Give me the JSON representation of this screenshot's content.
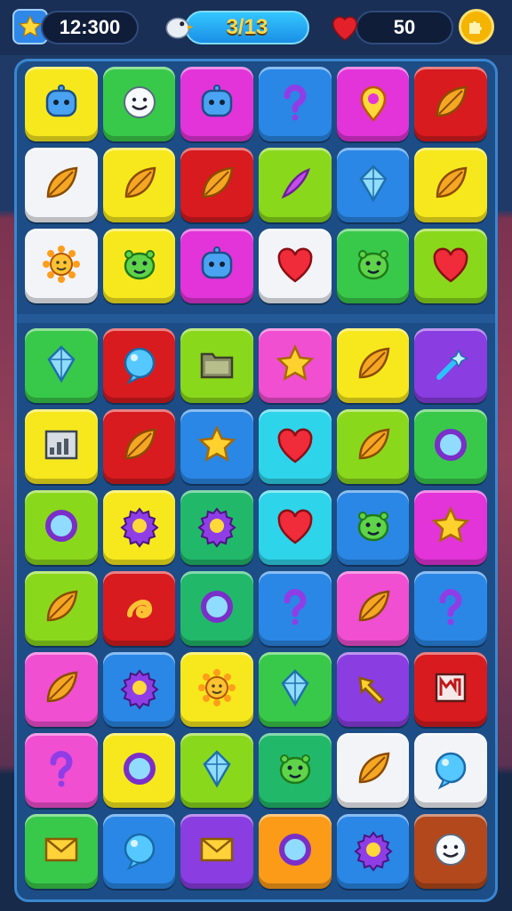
{
  "hud": {
    "score": "12:300",
    "level": "3/13",
    "lives": "50"
  },
  "colors": {
    "yellow": "#f7e81d",
    "green": "#39c94a",
    "lime": "#8ad81c",
    "magenta": "#e234d8",
    "blue": "#2a87e6",
    "red": "#d81b1f",
    "white": "#f2f4f8",
    "purple": "#8a3de0",
    "cyan": "#2ed4ea",
    "pink": "#f04fd1",
    "orange": "#fb9b18",
    "brown": "#b2481c",
    "emerald": "#22b86a"
  },
  "board": {
    "top_rows": [
      [
        {
          "color": "yellow",
          "icon": "robot-icon"
        },
        {
          "color": "green",
          "icon": "smiley-icon"
        },
        {
          "color": "magenta",
          "icon": "robot-icon"
        },
        {
          "color": "blue",
          "icon": "question-icon"
        },
        {
          "color": "magenta",
          "icon": "location-pin-icon"
        },
        {
          "color": "red",
          "icon": "leaf-icon"
        }
      ],
      [
        {
          "color": "white",
          "icon": "leaf-icon"
        },
        {
          "color": "yellow",
          "icon": "leaf-icon"
        },
        {
          "color": "red",
          "icon": "leaf-icon"
        },
        {
          "color": "lime",
          "icon": "feather-icon"
        },
        {
          "color": "blue",
          "icon": "crystal-icon"
        },
        {
          "color": "yellow",
          "icon": "leaf-icon"
        }
      ],
      [
        {
          "color": "white",
          "icon": "sun-icon"
        },
        {
          "color": "yellow",
          "icon": "monster-icon"
        },
        {
          "color": "magenta",
          "icon": "robot-icon"
        },
        {
          "color": "white",
          "icon": "heart-icon"
        },
        {
          "color": "green",
          "icon": "monster-icon"
        },
        {
          "color": "lime",
          "icon": "heart-icon"
        }
      ]
    ],
    "bottom_rows": [
      [
        {
          "color": "green",
          "icon": "crystal-icon"
        },
        {
          "color": "red",
          "icon": "bubble-icon"
        },
        {
          "color": "lime",
          "icon": "folder-icon"
        },
        {
          "color": "pink",
          "icon": "star-icon"
        },
        {
          "color": "yellow",
          "icon": "leaf-icon"
        },
        {
          "color": "purple",
          "icon": "wand-icon"
        }
      ],
      [
        {
          "color": "yellow",
          "icon": "chart-icon"
        },
        {
          "color": "red",
          "icon": "leaf-icon"
        },
        {
          "color": "blue",
          "icon": "star-icon"
        },
        {
          "color": "cyan",
          "icon": "heart-icon"
        },
        {
          "color": "lime",
          "icon": "leaf-icon"
        },
        {
          "color": "green",
          "icon": "ring-icon"
        }
      ],
      [
        {
          "color": "lime",
          "icon": "ring-icon"
        },
        {
          "color": "yellow",
          "icon": "gear-icon"
        },
        {
          "color": "emerald",
          "icon": "gear-icon"
        },
        {
          "color": "cyan",
          "icon": "heart-icon"
        },
        {
          "color": "blue",
          "icon": "monster-icon"
        },
        {
          "color": "magenta",
          "icon": "star-icon"
        }
      ],
      [
        {
          "color": "lime",
          "icon": "leaf-icon"
        },
        {
          "color": "red",
          "icon": "swirl-icon"
        },
        {
          "color": "emerald",
          "icon": "ring-icon"
        },
        {
          "color": "blue",
          "icon": "question-icon"
        },
        {
          "color": "pink",
          "icon": "leaf-icon"
        },
        {
          "color": "blue",
          "icon": "question-icon"
        }
      ],
      [
        {
          "color": "pink",
          "icon": "leaf-icon"
        },
        {
          "color": "blue",
          "icon": "gear-icon"
        },
        {
          "color": "yellow",
          "icon": "sun-icon"
        },
        {
          "color": "green",
          "icon": "crystal-icon"
        },
        {
          "color": "purple",
          "icon": "arrow-icon"
        },
        {
          "color": "red",
          "icon": "frame-icon"
        }
      ],
      [
        {
          "color": "pink",
          "icon": "question-icon"
        },
        {
          "color": "yellow",
          "icon": "ring-icon"
        },
        {
          "color": "lime",
          "icon": "crystal-icon"
        },
        {
          "color": "emerald",
          "icon": "monster-icon"
        },
        {
          "color": "white",
          "icon": "leaf-icon"
        },
        {
          "color": "white",
          "icon": "bubble-icon"
        }
      ],
      [
        {
          "color": "green",
          "icon": "envelope-icon"
        },
        {
          "color": "blue",
          "icon": "bubble-icon"
        },
        {
          "color": "purple",
          "icon": "envelope-icon"
        },
        {
          "color": "orange",
          "icon": "ring-icon"
        },
        {
          "color": "blue",
          "icon": "gear-icon"
        },
        {
          "color": "brown",
          "icon": "smiley-icon"
        }
      ]
    ]
  }
}
